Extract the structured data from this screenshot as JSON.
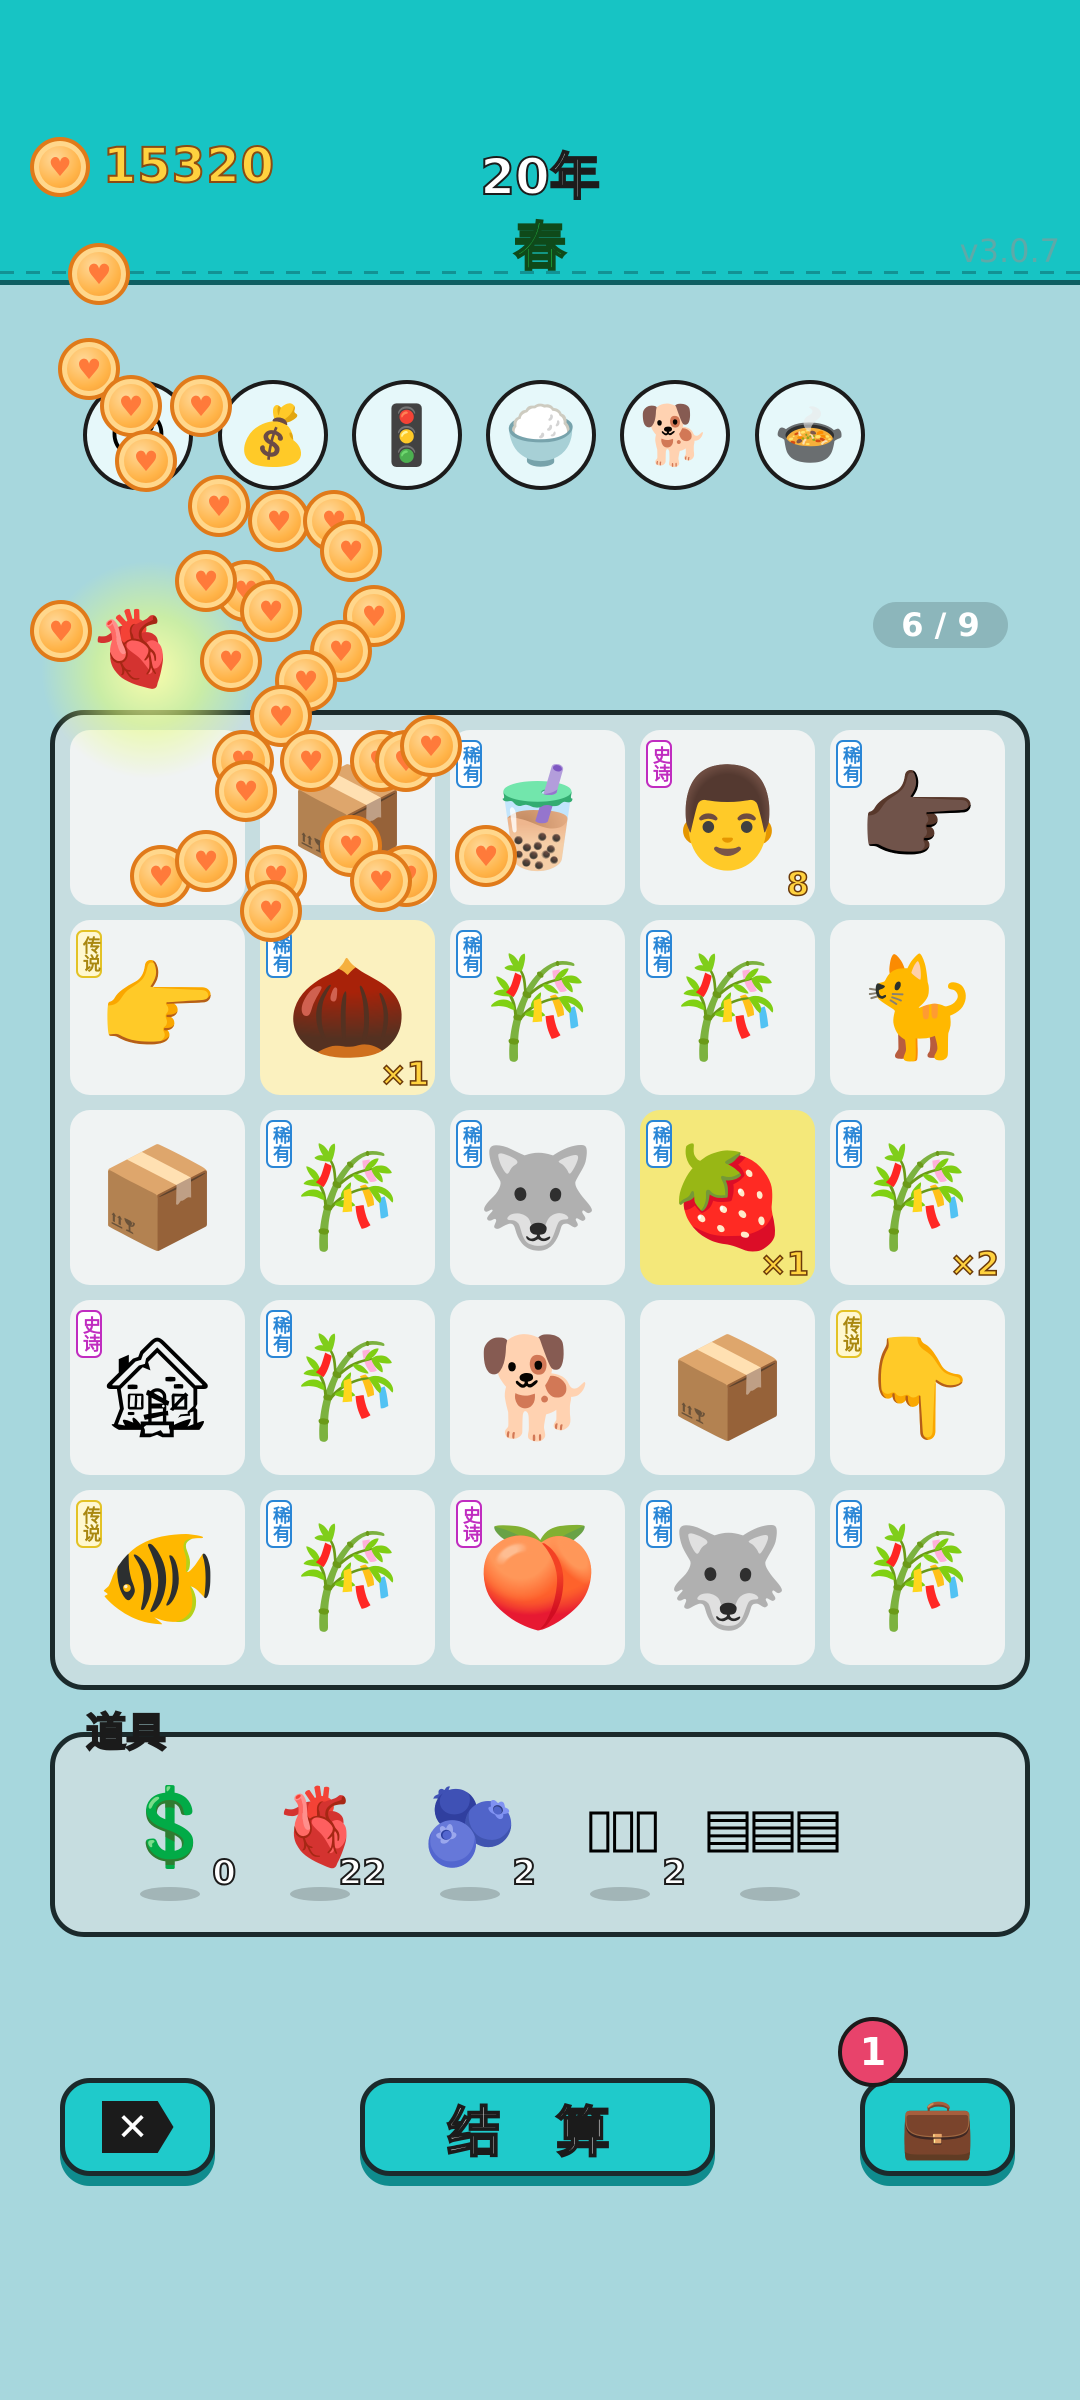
{
  "header": {
    "coin_icon": "coin-heart-icon",
    "money": "15320",
    "year": "20年",
    "season": "春",
    "version": "v3.0.7",
    "colors": {
      "bar": "#17c4c4",
      "money": "#ffd23f",
      "season": "#27d34a"
    }
  },
  "shop": [
    {
      "name": "sunglasses-creature-icon",
      "glyph": "😎"
    },
    {
      "name": "sack-icon",
      "glyph": "💰"
    },
    {
      "name": "ghost-traffic-light-icon",
      "glyph": "🚦"
    },
    {
      "name": "rice-bowl-icon",
      "glyph": "🍚"
    },
    {
      "name": "shiba-dog-icon",
      "glyph": "🐕"
    },
    {
      "name": "cooking-pot-chick-icon",
      "glyph": "🍲"
    }
  ],
  "page_counter": "6 / 9",
  "board": {
    "cells": [
      {
        "name": "box",
        "glyph": "📦",
        "tag": "",
        "tagType": "",
        "mult": ""
      },
      {
        "name": "bubble-tea",
        "glyph": "🧋",
        "tag": "稀有",
        "tagType": "rare",
        "mult": ""
      },
      {
        "name": "man-face",
        "glyph": "👨",
        "tag": "史诗",
        "tagType": "epic",
        "mult": "8"
      },
      {
        "name": "brown-pointing-hand",
        "glyph": "👉🏿",
        "tag": "稀有",
        "tagType": "rare",
        "mult": ""
      },
      {
        "name": "yellow-pointing-hand",
        "glyph": "👉",
        "tag": "传说",
        "tagType": "legend",
        "mult": ""
      },
      {
        "name": "brown-ball",
        "glyph": "🌰",
        "tag": "稀有",
        "tagType": "rare",
        "mult": "×1",
        "hl": "hl"
      },
      {
        "name": "bamboo",
        "glyph": "🎋",
        "tag": "稀有",
        "tagType": "rare",
        "mult": ""
      },
      {
        "name": "bamboo",
        "glyph": "🎋",
        "tag": "稀有",
        "tagType": "rare",
        "mult": ""
      },
      {
        "name": "yellow-cat",
        "glyph": "🐈",
        "tag": "",
        "tagType": "",
        "mult": ""
      },
      {
        "name": "box",
        "glyph": "📦",
        "tag": "",
        "tagType": "",
        "mult": ""
      },
      {
        "name": "bamboo",
        "glyph": "🎋",
        "tag": "稀有",
        "tagType": "rare",
        "mult": ""
      },
      {
        "name": "husky",
        "glyph": "🐺",
        "tag": "稀有",
        "tagType": "rare",
        "mult": ""
      },
      {
        "name": "lychee",
        "glyph": "🍓",
        "tag": "稀有",
        "tagType": "rare",
        "mult": "×1",
        "hl": "hl2"
      },
      {
        "name": "bamboo",
        "glyph": "🎋",
        "tag": "稀有",
        "tagType": "rare",
        "mult": "×2"
      },
      {
        "name": "haunted-house",
        "glyph": "🏚",
        "tag": "史诗",
        "tagType": "epic",
        "mult": ""
      },
      {
        "name": "bamboo",
        "glyph": "🎋",
        "tag": "稀有",
        "tagType": "rare",
        "mult": ""
      },
      {
        "name": "brown-dog",
        "glyph": "🐕",
        "tag": "",
        "tagType": "",
        "mult": ""
      },
      {
        "name": "box",
        "glyph": "📦",
        "tag": "",
        "tagType": "",
        "mult": ""
      },
      {
        "name": "yellow-pointing-hand",
        "glyph": "👇",
        "tag": "传说",
        "tagType": "legend",
        "mult": ""
      },
      {
        "name": "koi-fish",
        "glyph": "🐠",
        "tag": "传说",
        "tagType": "legend",
        "mult": ""
      },
      {
        "name": "bamboo",
        "glyph": "🎋",
        "tag": "稀有",
        "tagType": "rare",
        "mult": ""
      },
      {
        "name": "peach",
        "glyph": "🍑",
        "tag": "史诗",
        "tagType": "epic",
        "mult": ""
      },
      {
        "name": "husky",
        "glyph": "🐺",
        "tag": "稀有",
        "tagType": "rare",
        "mult": ""
      },
      {
        "name": "bamboo",
        "glyph": "🎋",
        "tag": "稀有",
        "tagType": "rare",
        "mult": ""
      }
    ]
  },
  "items": {
    "title": "道具",
    "list": [
      {
        "name": "dollar-coin-icon",
        "glyph": "💲",
        "qty": "0"
      },
      {
        "name": "liver-icon",
        "glyph": "🫀",
        "qty": "22"
      },
      {
        "name": "blueberry-icon",
        "glyph": "🫐",
        "qty": "2"
      },
      {
        "name": "empty-slots-icon",
        "glyph": "▯▯▯",
        "qty": "2"
      },
      {
        "name": "rare-slots-icon",
        "glyph": "▤▤▤",
        "qty": ""
      }
    ]
  },
  "buttons": {
    "settle": "结 算",
    "bag_badge": "1"
  }
}
